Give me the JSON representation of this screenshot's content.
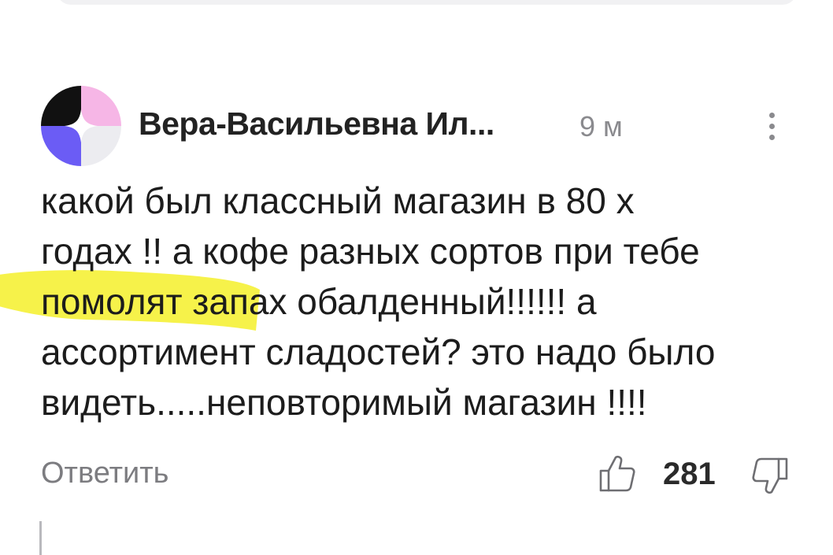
{
  "comment": {
    "author": "Вера-Васильевна Ил...",
    "time": "9 м",
    "text": "какой был классный магазин в 80 х\nгодах !! а кофе разных сортов при тебе\nпомолят запах обалденный!!!!!! а\nассортимент сладостей? это надо было\nвидеть.....неповторимый магазин !!!!",
    "highlight_color": "#f5f02a"
  },
  "actions": {
    "reply_label": "Ответить",
    "likes": "281",
    "like_icon": "thumbs-up-icon",
    "dislike_icon": "thumbs-down-icon"
  },
  "colors": {
    "avatar_black": "#111111",
    "avatar_pink": "#f6b6e6",
    "avatar_purple": "#6b5cf5",
    "avatar_gray": "#ececf0"
  }
}
